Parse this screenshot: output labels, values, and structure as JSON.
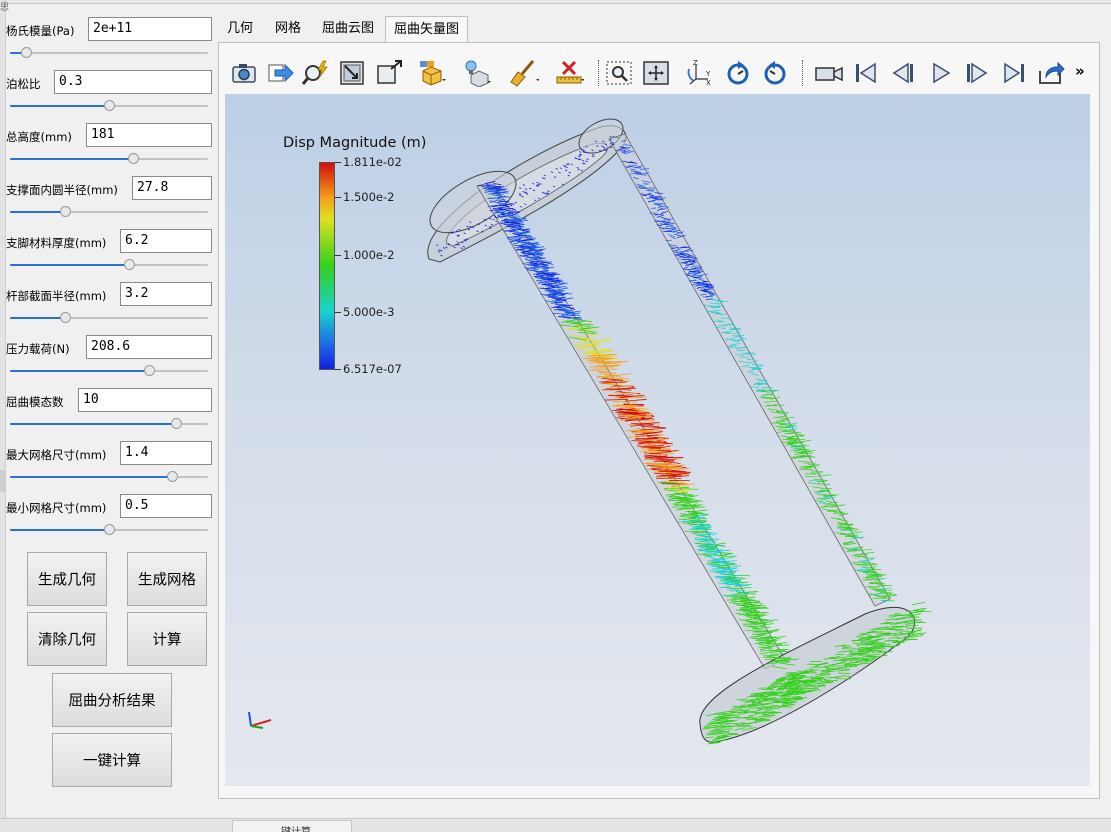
{
  "window": {
    "corner_glyph": "思"
  },
  "parameters": [
    {
      "label": "杨氏模量(Pa)",
      "value": "2e+11",
      "slider_fraction": 0.08
    },
    {
      "label": "泊松比",
      "value": "0.3",
      "slider_fraction": 0.5
    },
    {
      "label": "总高度(mm)",
      "value": "181",
      "slider_fraction": 0.62
    },
    {
      "label": "支撑面内圆半径(mm)",
      "value": "27.8",
      "slider_fraction": 0.28
    },
    {
      "label": "支脚材料厚度(mm)",
      "value": "6.2",
      "slider_fraction": 0.6
    },
    {
      "label": "杆部截面半径(mm)",
      "value": "3.2",
      "slider_fraction": 0.28
    },
    {
      "label": "压力载荷(N)",
      "value": "208.6",
      "slider_fraction": 0.7
    },
    {
      "label": "屈曲模态数",
      "value": "10",
      "slider_fraction": 0.84
    },
    {
      "label": "最大网格尺寸(mm)",
      "value": "1.4",
      "slider_fraction": 0.82
    },
    {
      "label": "最小网格尺寸(mm)",
      "value": "0.5",
      "slider_fraction": 0.5
    }
  ],
  "buttons": {
    "generate_geometry": "生成几何",
    "generate_mesh": "生成网格",
    "clear_geometry": "清除几何",
    "compute": "计算",
    "buckling_results": "屈曲分析结果",
    "one_click_compute": "一键计算"
  },
  "tabs": [
    {
      "label": "几何",
      "active": false
    },
    {
      "label": "网格",
      "active": false
    },
    {
      "label": "屈曲云图",
      "active": false
    },
    {
      "label": "屈曲矢量图",
      "active": true
    }
  ],
  "toolbar": {
    "icons": [
      "camera-icon",
      "export-arrow-icon",
      "magnify-lightning-icon",
      "reset-camera-icon",
      "zoom-to-box-icon",
      "color-cube-dropdown-icon",
      "light-cube-dropdown-icon",
      "broom-icon",
      "ruler-delete-icon",
      "zoom-region-icon",
      "fit-all-icon",
      "axes-orientation-icon",
      "rotate-cw-icon",
      "rotate-ccw-icon",
      "video-camera-icon",
      "first-frame-icon",
      "step-back-icon",
      "play-icon",
      "step-forward-icon",
      "last-frame-icon",
      "share-icon"
    ],
    "overflow": "»"
  },
  "viewport": {
    "legend_title": "Disp Magnitude (m)",
    "legend_ticks": [
      "1.811e-02",
      "1.500e-2",
      "1.000e-2",
      "5.000e-3",
      "6.517e-07"
    ],
    "colormap": [
      "#d40d0d",
      "#f5a019",
      "#e0e020",
      "#33d11c",
      "#17d3cf",
      "#1d5ee8",
      "#1020e0"
    ],
    "background_top": "#bccfe6",
    "background_bottom": "#e5e8ef"
  },
  "taskbar_stub": "键计算"
}
